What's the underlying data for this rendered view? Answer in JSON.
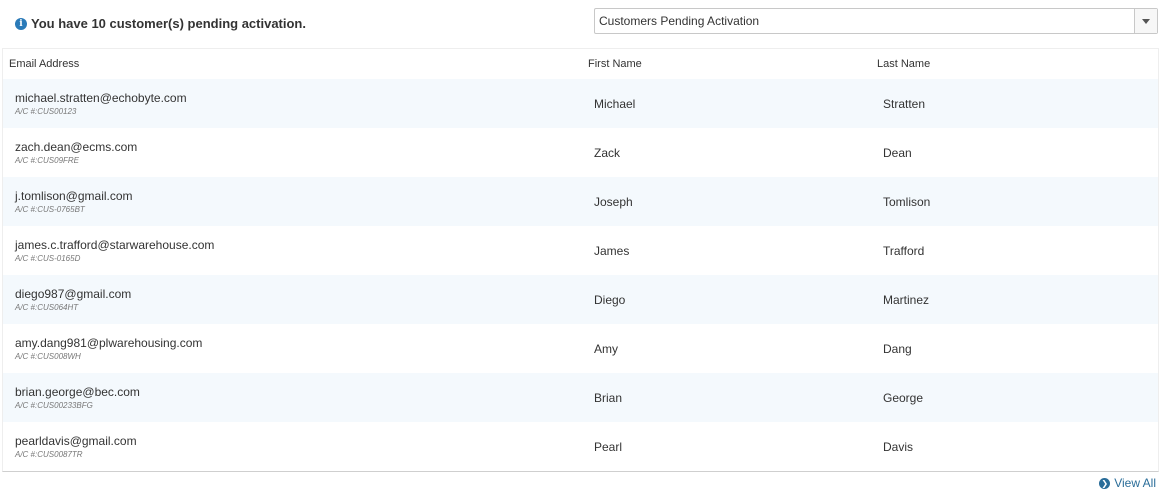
{
  "notice": {
    "icon": "info-icon",
    "text": "You have 10 customer(s) pending activation."
  },
  "filter": {
    "selected": "Customers Pending Activation"
  },
  "table": {
    "columns": [
      "Email Address",
      "First Name",
      "Last Name"
    ],
    "rows": [
      {
        "email": "michael.stratten@echobyte.com",
        "account": "A/C #:CUS00123",
        "first": "Michael",
        "last": "Stratten"
      },
      {
        "email": "zach.dean@ecms.com",
        "account": "A/C #:CUS09FRE",
        "first": "Zack",
        "last": "Dean"
      },
      {
        "email": "j.tomlison@gmail.com",
        "account": "A/C #:CUS-0765BT",
        "first": "Joseph",
        "last": "Tomlison"
      },
      {
        "email": "james.c.trafford@starwarehouse.com",
        "account": "A/C #:CUS-0165D",
        "first": "James",
        "last": "Trafford"
      },
      {
        "email": "diego987@gmail.com",
        "account": "A/C #:CUS064HT",
        "first": "Diego",
        "last": "Martinez"
      },
      {
        "email": "amy.dang981@plwarehousing.com",
        "account": "A/C #:CUS008WH",
        "first": "Amy",
        "last": "Dang"
      },
      {
        "email": "brian.george@bec.com",
        "account": "A/C #:CUS00233BFG",
        "first": "Brian",
        "last": "George"
      },
      {
        "email": "pearldavis@gmail.com",
        "account": "A/C #:CUS0087TR",
        "first": "Pearl",
        "last": "Davis"
      }
    ]
  },
  "footer": {
    "view_all": "View All",
    "icon": "chevron-circle-right-icon"
  },
  "colors": {
    "accent": "#2a6d99",
    "row_stripe": "#f4f9fd"
  }
}
